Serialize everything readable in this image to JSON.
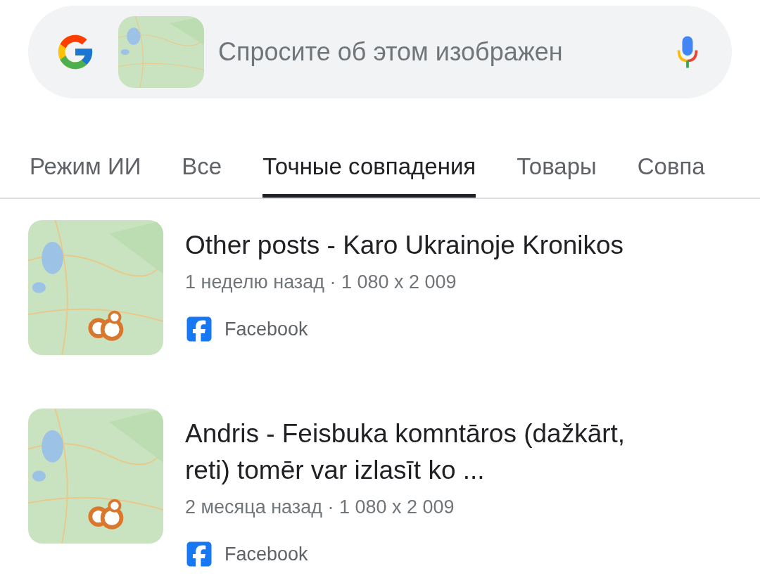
{
  "search": {
    "placeholder": "Спросите об этом изображен"
  },
  "tabs": [
    {
      "label": "Режим ИИ",
      "selected": false
    },
    {
      "label": "Все",
      "selected": false
    },
    {
      "label": "Точные совпадения",
      "selected": true
    },
    {
      "label": "Товары",
      "selected": false
    },
    {
      "label": "Совпа",
      "selected": false
    }
  ],
  "results": [
    {
      "title": "Other posts - Karo Ukrainoje Kronikos",
      "meta": "1 неделю назад · 1 080 x 2 009",
      "source": "Facebook"
    },
    {
      "title": "Andris - Feisbuka komntāros (dažkārt, reti) tomēr var izlasīt ko ...",
      "meta": "2 месяца назад · 1 080 x 2 009",
      "source": "Facebook"
    }
  ]
}
